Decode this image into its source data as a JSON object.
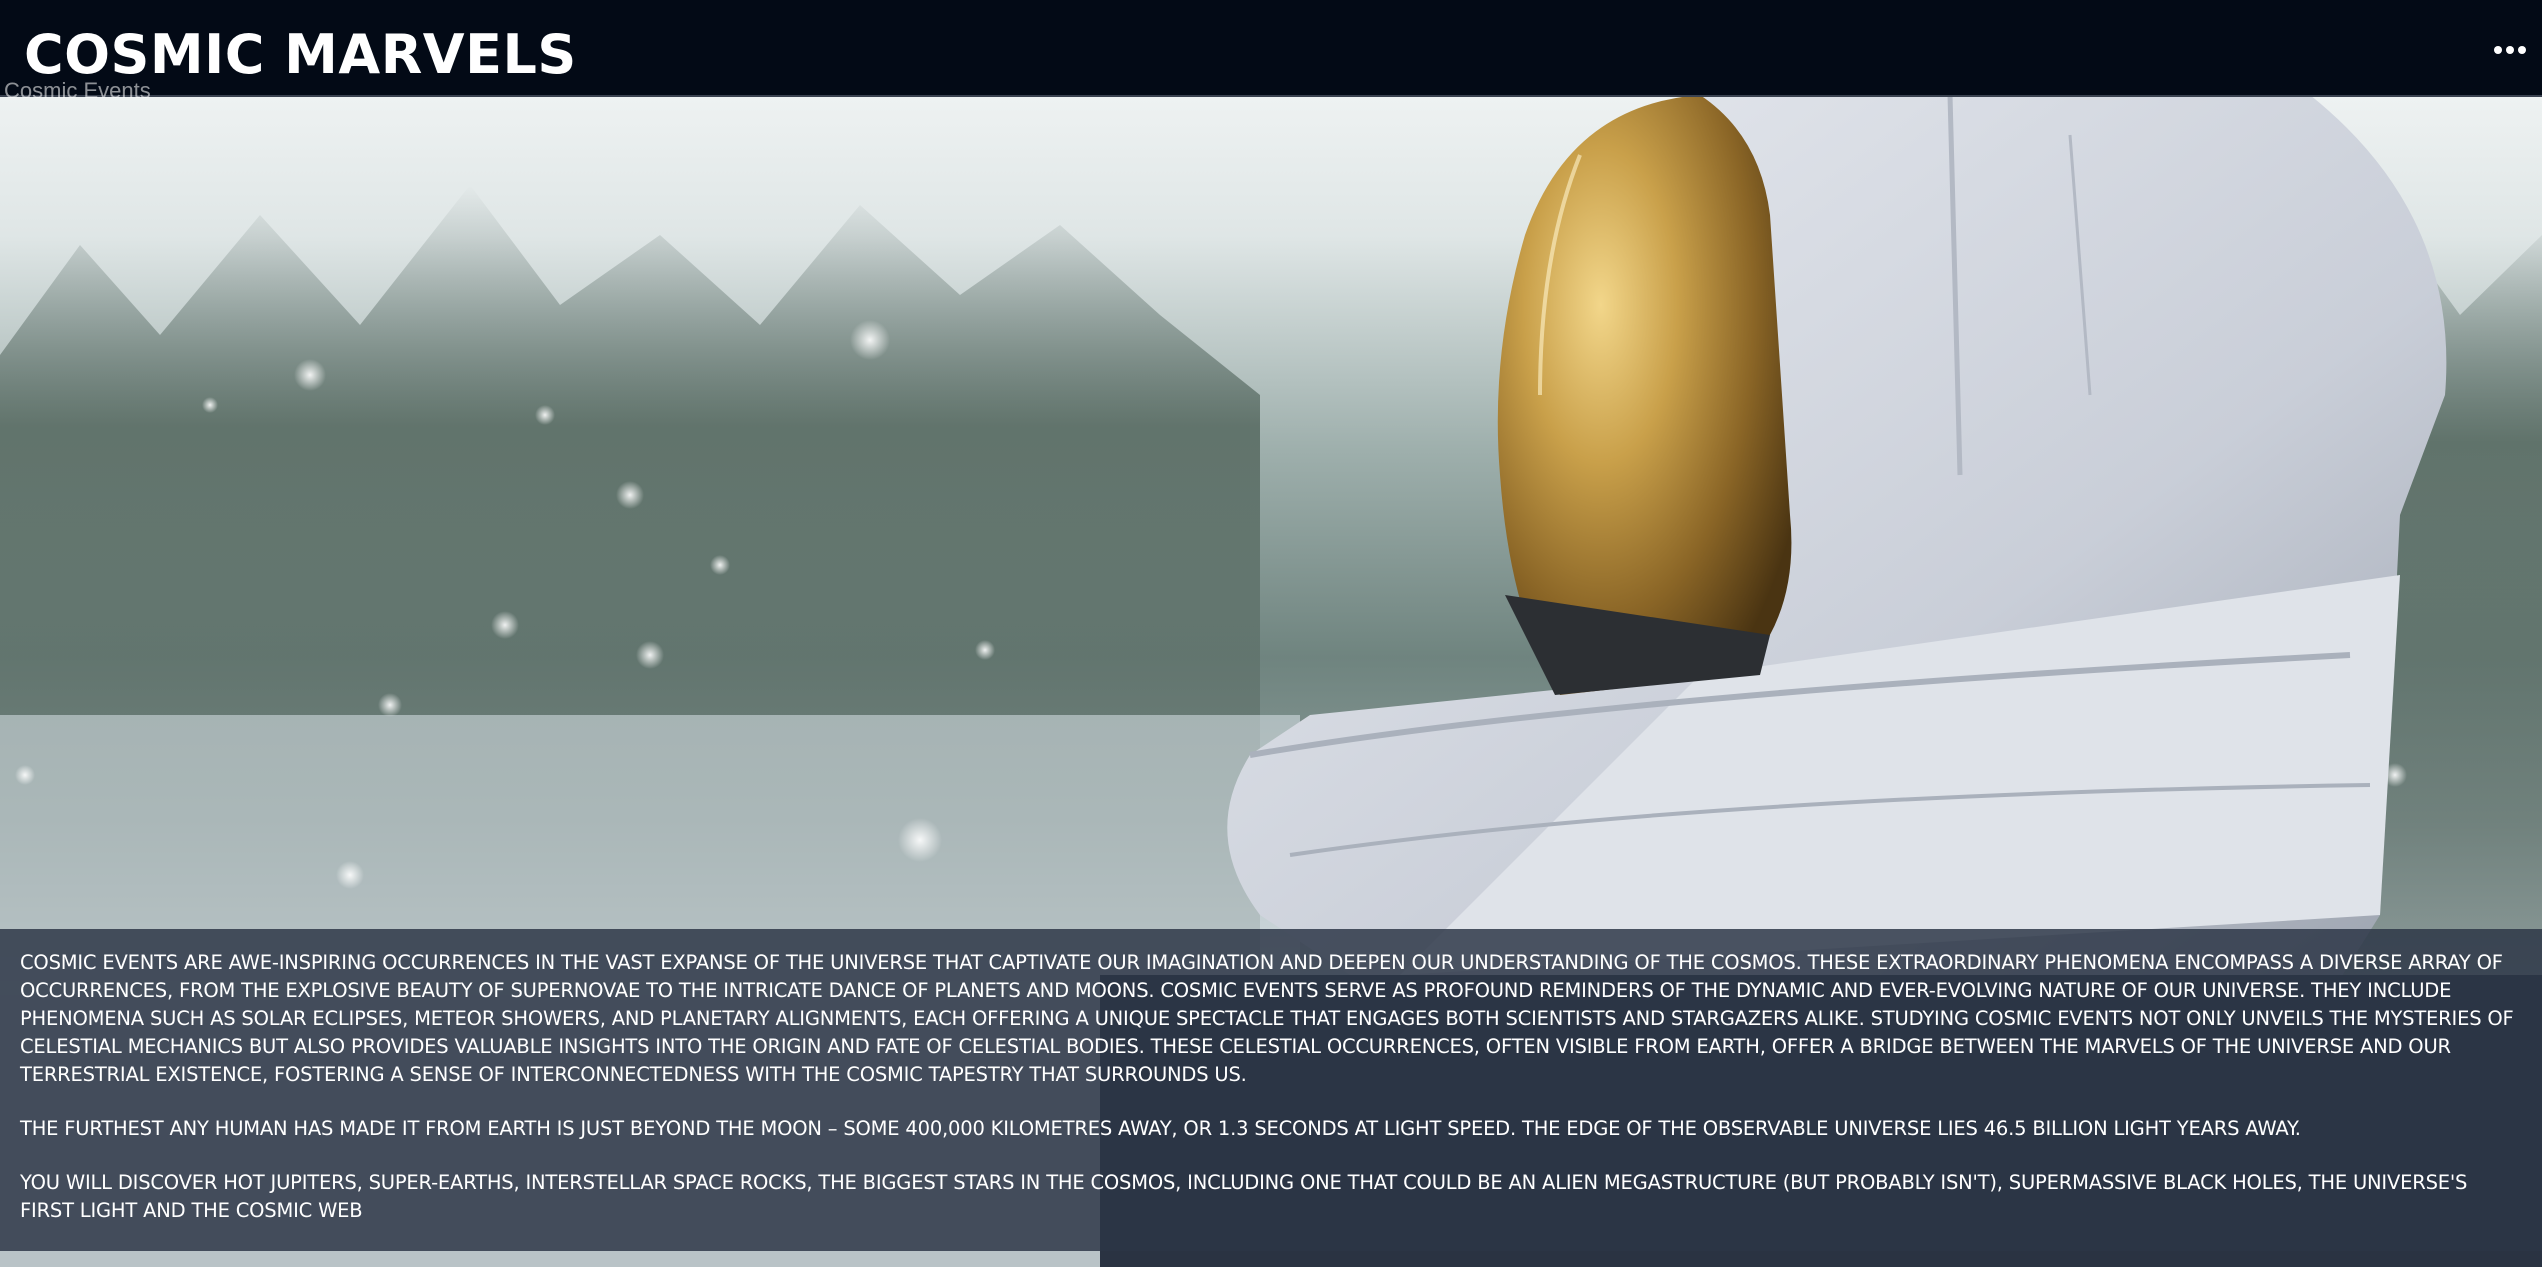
{
  "header": {
    "title": "COSMIC MARVELS",
    "menu_icon": "more-horizontal-icon"
  },
  "breadcrumb_ghost": "Cosmic Events",
  "hero": {
    "image_description_icon": "astronaut-helmet-photo"
  },
  "content": {
    "paragraphs": [
      "Cosmic events are awe-inspiring occurrences in the vast expanse of the universe that captivate our imagination and deepen our understanding of the cosmos. These extraordinary phenomena encompass a diverse array of occurrences, from the explosive beauty of supernovae to the intricate dance of planets and moons. Cosmic events serve as profound reminders of the dynamic and ever-evolving nature of our universe. They include phenomena such as solar eclipses, meteor showers, and planetary alignments, each offering a unique spectacle that engages both scientists and stargazers alike. Studying cosmic events not only unveils the mysteries of celestial mechanics but also provides valuable insights into the origin and fate of celestial bodies. These celestial occurrences, often visible from Earth, offer a bridge between the marvels of the universe and our terrestrial existence, fostering a sense of interconnectedness with the cosmic tapestry that surrounds us.",
      "The furthest any human has made it from Earth is just beyond the Moon – some 400,000 kilometres away, or 1.3 seconds at light speed. The edge of the observable Universe lies 46.5 billion light years away.",
      "You will discover hot Jupiters, super-Earths, interstellar space rocks, the biggest stars in the cosmos, including one that could be an alien megastructure (but probably isn't), supermassive black holes, the Universe's first light and the cosmic web"
    ]
  },
  "colors": {
    "header_bg": "#030a16",
    "panel_bg": "#2c3646",
    "text": "#ffffff"
  }
}
